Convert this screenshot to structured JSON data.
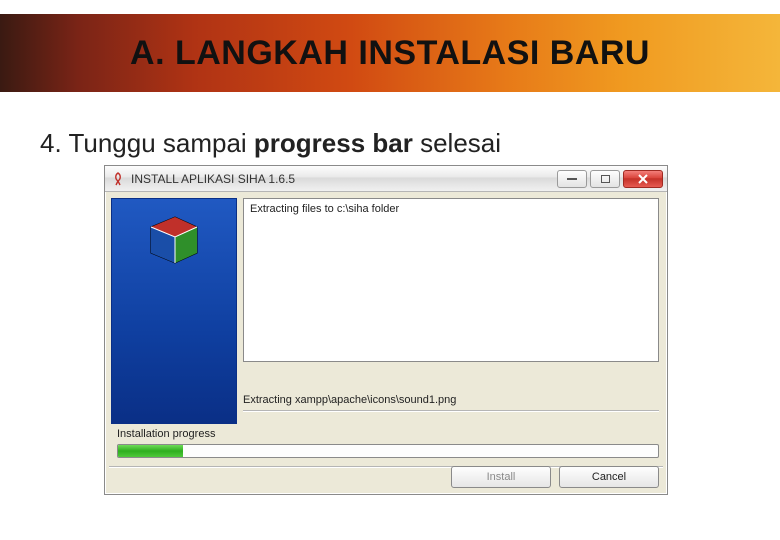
{
  "banner": {
    "title": "A. LANGKAH INSTALASI BARU"
  },
  "step": {
    "prefix": "4. Tunggu sampai ",
    "bold": "progress bar",
    "suffix": " selesai"
  },
  "window": {
    "title": "INSTALL APLIKASI SIHA 1.6.5",
    "log_line": "Extracting files to c:\\siha folder",
    "status_line": "Extracting xampp\\apache\\icons\\sound1.png",
    "progress_label": "Installation progress",
    "progress_percent": 12,
    "buttons": {
      "install": "Install",
      "cancel": "Cancel"
    }
  }
}
